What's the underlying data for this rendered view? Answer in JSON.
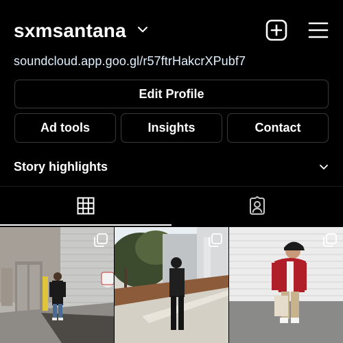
{
  "profile": {
    "username": "sxmsantana",
    "link": "soundcloud.app.goo.gl/r57ftrHakcrXPubf7"
  },
  "buttons": {
    "edit_profile": "Edit Profile",
    "ad_tools": "Ad tools",
    "insights": "Insights",
    "contact": "Contact"
  },
  "highlights": {
    "label": "Story highlights"
  },
  "tabs": [
    {
      "icon": "grid-icon",
      "active": true
    },
    {
      "icon": "tagged-icon",
      "active": false
    }
  ],
  "posts": [
    {
      "description_icon": "multi-photo-icon"
    },
    {
      "description_icon": "multi-photo-icon"
    },
    {
      "description_icon": "multi-photo-icon"
    }
  ],
  "colors": {
    "background": "#000000",
    "text": "#ffffff",
    "link": "#e0f1ff",
    "button_border": "#3a3a3a"
  }
}
